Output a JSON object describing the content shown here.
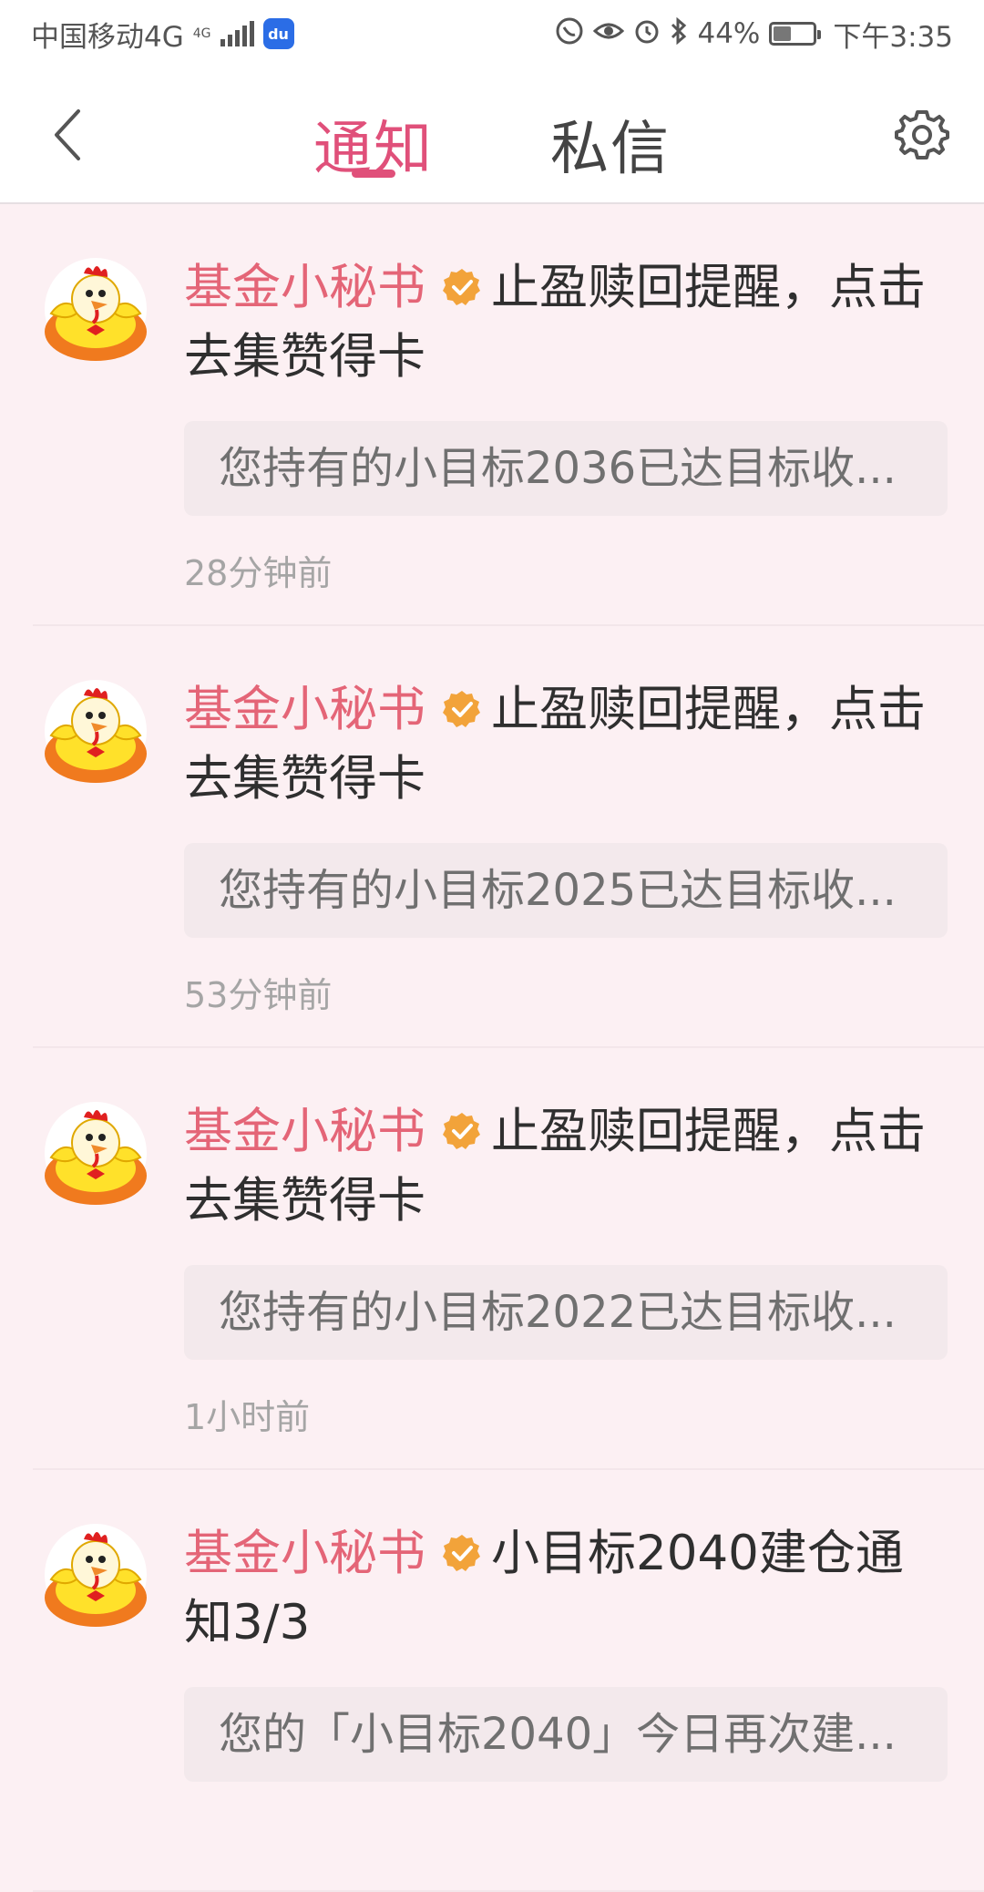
{
  "status_bar": {
    "carrier": "中国移动4G",
    "network_badge": "4G",
    "battery": "44%",
    "time": "下午3:35",
    "icons": [
      "hd-call-icon",
      "eye-icon",
      "alarm-icon",
      "bluetooth-icon"
    ]
  },
  "header": {
    "tabs": [
      {
        "label": "通知",
        "active": true
      },
      {
        "label": "私信",
        "active": false
      }
    ]
  },
  "colors": {
    "accent": "#e0507a",
    "sender": "#e46577",
    "background": "#fcf0f3",
    "preview_bg": "#f3e9ec",
    "verified": "#f2a33a"
  },
  "notifications": [
    {
      "sender": "基金小秘书",
      "title": "止盈赎回提醒，点击去集赞得卡",
      "preview": "您持有的小目标2036已达目标收...",
      "time": "28分钟前"
    },
    {
      "sender": "基金小秘书",
      "title": "止盈赎回提醒，点击去集赞得卡",
      "preview": "您持有的小目标2025已达目标收...",
      "time": "53分钟前"
    },
    {
      "sender": "基金小秘书",
      "title": "止盈赎回提醒，点击去集赞得卡",
      "preview": "您持有的小目标2022已达目标收...",
      "time": "1小时前"
    },
    {
      "sender": "基金小秘书",
      "title": "小目标2040建仓通知3/3",
      "preview": "您的「小目标2040」今日再次建...",
      "time": ""
    }
  ]
}
